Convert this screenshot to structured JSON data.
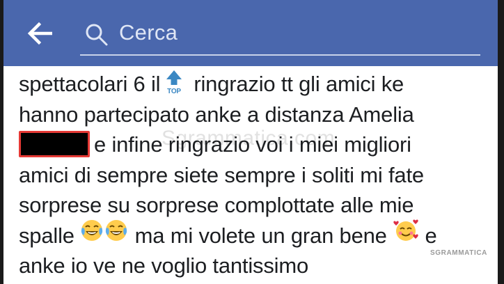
{
  "header": {
    "back_icon": "arrow-left-icon",
    "search_icon": "search-icon",
    "search_placeholder": "Cerca",
    "bar_color": "#4a67ad"
  },
  "post": {
    "lines": [
      {
        "before": "spettacolari 6 il",
        "emoji": "top-arrow-emoji",
        "after": "ringrazio tt gli amici ke"
      },
      {
        "text": "hanno partecipato anke a distanza Amelia"
      },
      {
        "redacted": true,
        "after": "e infine ringrazio voi i miei migliori"
      },
      {
        "text": "amici di sempre siete sempre i soliti mi fate"
      },
      {
        "text": "sorprese su sorprese complottate alle mie"
      },
      {
        "before": "spalle",
        "emoji": "tears-of-joy-emoji",
        "middle": "ma mi volete un gran bene",
        "emoji2": "smiling-face-with-hearts-emoji",
        "after": "e"
      },
      {
        "text": "anke io ve ne voglio tantissimo"
      }
    ],
    "top_label": "TOP"
  },
  "watermark": "Sgrammatica.com",
  "brand": "SGRAMMATICA"
}
